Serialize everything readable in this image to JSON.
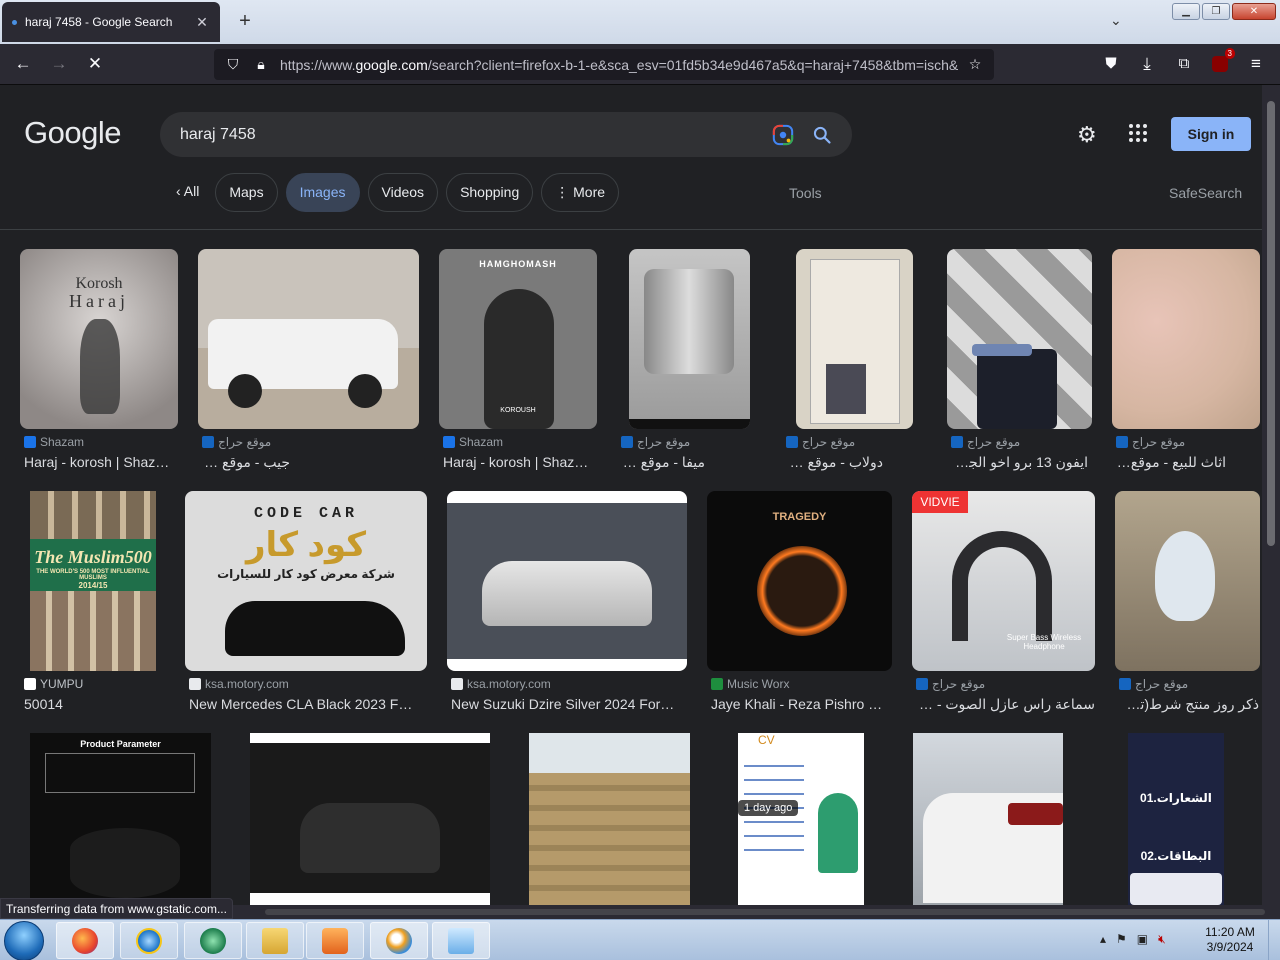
{
  "browser": {
    "tab_title": "haraj 7458 - Google Search",
    "url_host_prefix": "https://www.",
    "url_host": "google.com",
    "url_rest": "/search?client=firefox-b-1-e&sca_esv=01fd5b34e9d467a5&q=haraj+7458&tbm=isch&",
    "extension_badge": "3",
    "status_text": "Transferring data from www.gstatic.com..."
  },
  "google": {
    "logo": "Google",
    "query": "haraj 7458",
    "sign_in": "Sign in",
    "chips": [
      "All",
      "Maps",
      "Images",
      "Videos",
      "Shopping",
      "More"
    ],
    "active_chip": "Images",
    "tools": "Tools",
    "safesearch": "SafeSearch"
  },
  "results": [
    {
      "source": "Shazam",
      "caption": "Haraj - korosh | Shaz…",
      "rtl": false,
      "fav": "#1a73e8"
    },
    {
      "source": "موقع حراج",
      "caption": "جيب - موقع حراج",
      "rtl": true,
      "fav": "#1565c0"
    },
    {
      "source": "Shazam",
      "caption": "Haraj - korosh | Shaz…",
      "rtl": false,
      "fav": "#1a73e8"
    },
    {
      "source": "موقع حراج",
      "caption": "ميفا - موقع حراج",
      "rtl": true,
      "fav": "#1565c0"
    },
    {
      "source": "موقع حراج",
      "caption": "دولاب - موقع حراج",
      "rtl": true,
      "fav": "#1565c0"
    },
    {
      "source": "موقع حراج",
      "caption": "ايفون 13 برو اخو الجديد …",
      "rtl": true,
      "fav": "#1565c0"
    },
    {
      "source": "موقع حراج",
      "caption": "اثاث للبيع - موقع حراج",
      "rtl": true,
      "fav": "#1565c0"
    },
    {
      "source": "YUMPU",
      "caption": "50014",
      "rtl": false,
      "fav": "#222222"
    },
    {
      "source": "ksa.motory.com",
      "caption": "New Mercedes CLA Black 2023 F…",
      "rtl": false,
      "fav": "#5f6368"
    },
    {
      "source": "ksa.motory.com",
      "caption": "New Suzuki Dzire Silver 2024 For…",
      "rtl": false,
      "fav": "#5f6368"
    },
    {
      "source": "Music Worx",
      "caption": "Jaye Khali - Reza Pishro …",
      "rtl": false,
      "fav": "#1e8e3e"
    },
    {
      "source": "موقع حراج",
      "caption": "سماعة راس عازل الصوت - موقع…",
      "rtl": true,
      "fav": "#1565c0"
    },
    {
      "source": "موقع حراج",
      "caption": "ذكر روز منتج شرط(تم الب…",
      "rtl": true,
      "fav": "#1565c0"
    }
  ],
  "image_texts": {
    "korosh_title": "Korosh",
    "korosh_sub": "Haraj",
    "hamghomash": "HAMGHOMASH",
    "koroush": "KOROUSH",
    "muslim500": "The Muslim500",
    "muslim500_sub": "THE WORLD'S 500 MOST INFLUENTIAL MUSLIMS",
    "muslim500_year": "2014/15",
    "codecar": "CODE CAR",
    "codecar_ar": "كود كار",
    "codecar_sub": "شركة معرض كود كار للسيارات",
    "tragedy": "TRAGEDY",
    "vidvie": "VIDVIE",
    "headphone_sub": "Super Bass Wireless Headphone",
    "product_param": "Product Parameter",
    "cv": "CV",
    "shaarat": "01.الشعارات",
    "bitaqat": "02.البطاقات",
    "day_ago": "1 day ago"
  },
  "taskbar": {
    "time": "11:20 AM",
    "date": "3/9/2024"
  }
}
